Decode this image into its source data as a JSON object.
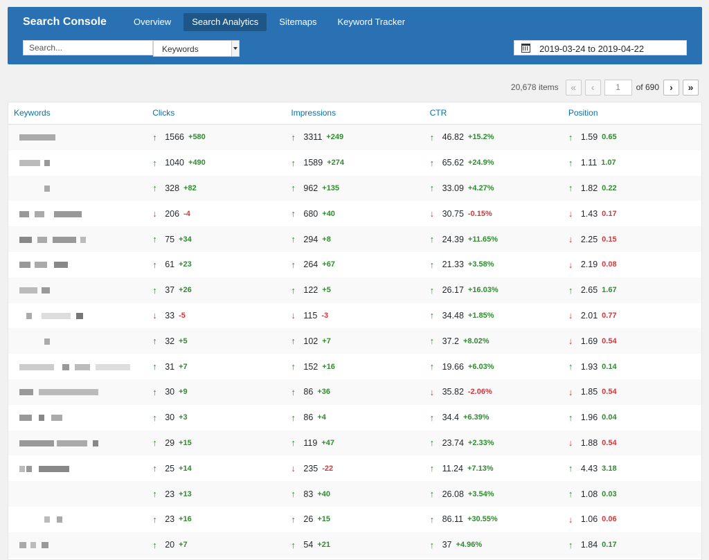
{
  "header": {
    "brand": "Search Console",
    "tabs": [
      {
        "label": "Overview",
        "active": false
      },
      {
        "label": "Search Analytics",
        "active": true
      },
      {
        "label": "Sitemaps",
        "active": false
      },
      {
        "label": "Keyword Tracker",
        "active": false
      }
    ],
    "search_placeholder": "Search...",
    "select_value": "Keywords",
    "date_range": "2019-03-24 to 2019-04-22"
  },
  "pagination": {
    "items": "20,678 items",
    "first": "«",
    "prev": "‹",
    "current": "1",
    "of_total": "of 690",
    "next": "›",
    "last": "»"
  },
  "table": {
    "columns": [
      "Keywords",
      "Clicks",
      "Impressions",
      "CTR",
      "Position"
    ],
    "rows": [
      {
        "clicks": [
          "up",
          "1566",
          "+580"
        ],
        "impr": [
          "up",
          "3311",
          "+249"
        ],
        "ctr": [
          "up",
          "46.82",
          "+15.2%"
        ],
        "pos": [
          "up",
          "1.59",
          "0.65"
        ]
      },
      {
        "clicks": [
          "up",
          "1040",
          "+490"
        ],
        "impr": [
          "up",
          "1589",
          "+274"
        ],
        "ctr": [
          "up",
          "65.62",
          "+24.9%"
        ],
        "pos": [
          "up",
          "1.11",
          "1.07"
        ]
      },
      {
        "clicks": [
          "up",
          "328",
          "+82"
        ],
        "impr": [
          "up",
          "962",
          "+135"
        ],
        "ctr": [
          "up",
          "33.09",
          "+4.27%"
        ],
        "pos": [
          "up",
          "1.82",
          "0.22"
        ]
      },
      {
        "clicks": [
          "down",
          "206",
          "-4"
        ],
        "impr": [
          "up",
          "680",
          "+40"
        ],
        "ctr": [
          "down",
          "30.75",
          "-0.15%"
        ],
        "pos": [
          "down",
          "1.43",
          "0.17"
        ]
      },
      {
        "clicks": [
          "up",
          "75",
          "+34"
        ],
        "impr": [
          "up",
          "294",
          "+8"
        ],
        "ctr": [
          "up",
          "24.39",
          "+11.65%"
        ],
        "pos": [
          "down",
          "2.25",
          "0.15"
        ]
      },
      {
        "clicks": [
          "up",
          "61",
          "+23"
        ],
        "impr": [
          "up",
          "264",
          "+67"
        ],
        "ctr": [
          "up",
          "21.33",
          "+3.58%"
        ],
        "pos": [
          "down",
          "2.19",
          "0.08"
        ]
      },
      {
        "clicks": [
          "up",
          "37",
          "+26"
        ],
        "impr": [
          "up",
          "122",
          "+5"
        ],
        "ctr": [
          "up",
          "26.17",
          "+16.03%"
        ],
        "pos": [
          "up",
          "2.65",
          "1.67"
        ]
      },
      {
        "clicks": [
          "down",
          "33",
          "-5"
        ],
        "impr": [
          "down",
          "115",
          "-3"
        ],
        "ctr": [
          "up",
          "34.48",
          "+1.85%"
        ],
        "pos": [
          "down",
          "2.01",
          "0.77"
        ]
      },
      {
        "clicks": [
          "up",
          "32",
          "+5"
        ],
        "impr": [
          "up",
          "102",
          "+7"
        ],
        "ctr": [
          "up",
          "37.2",
          "+8.02%"
        ],
        "pos": [
          "down",
          "1.69",
          "0.54"
        ]
      },
      {
        "clicks": [
          "up",
          "31",
          "+7"
        ],
        "impr": [
          "up",
          "152",
          "+16"
        ],
        "ctr": [
          "up",
          "19.66",
          "+6.03%"
        ],
        "pos": [
          "up",
          "1.93",
          "0.14"
        ]
      },
      {
        "clicks": [
          "up",
          "30",
          "+9"
        ],
        "impr": [
          "up",
          "86",
          "+36"
        ],
        "ctr": [
          "down",
          "35.82",
          "-2.06%"
        ],
        "pos": [
          "down",
          "1.85",
          "0.54"
        ]
      },
      {
        "clicks": [
          "up",
          "30",
          "+3"
        ],
        "impr": [
          "up",
          "86",
          "+4"
        ],
        "ctr": [
          "up",
          "34.4",
          "+6.39%"
        ],
        "pos": [
          "up",
          "1.96",
          "0.04"
        ]
      },
      {
        "clicks": [
          "up",
          "29",
          "+15"
        ],
        "impr": [
          "up",
          "119",
          "+47"
        ],
        "ctr": [
          "up",
          "23.74",
          "+2.33%"
        ],
        "pos": [
          "down",
          "1.88",
          "0.54"
        ]
      },
      {
        "clicks": [
          "up",
          "25",
          "+14"
        ],
        "impr": [
          "down",
          "235",
          "-22"
        ],
        "ctr": [
          "up",
          "11.24",
          "+7.13%"
        ],
        "pos": [
          "up",
          "4.43",
          "3.18"
        ]
      },
      {
        "clicks": [
          "up",
          "23",
          "+13"
        ],
        "impr": [
          "up",
          "83",
          "+40"
        ],
        "ctr": [
          "up",
          "26.08",
          "+3.54%"
        ],
        "pos": [
          "up",
          "1.08",
          "0.03"
        ]
      },
      {
        "clicks": [
          "up",
          "23",
          "+16"
        ],
        "impr": [
          "up",
          "26",
          "+15"
        ],
        "ctr": [
          "up",
          "86.11",
          "+30.55%"
        ],
        "pos": [
          "down",
          "1.06",
          "0.06"
        ]
      },
      {
        "clicks": [
          "up",
          "20",
          "+7"
        ],
        "impr": [
          "up",
          "54",
          "+21"
        ],
        "ctr": [
          "up",
          "37",
          "+4.96%"
        ],
        "pos": [
          "up",
          "1.84",
          "0.17"
        ]
      }
    ]
  },
  "colors": {
    "header_bg": "#2a71b4",
    "active_tab_bg": "#1d5687",
    "link": "#0073aa",
    "positive": "#2e8b2e",
    "negative": "#d63638"
  }
}
